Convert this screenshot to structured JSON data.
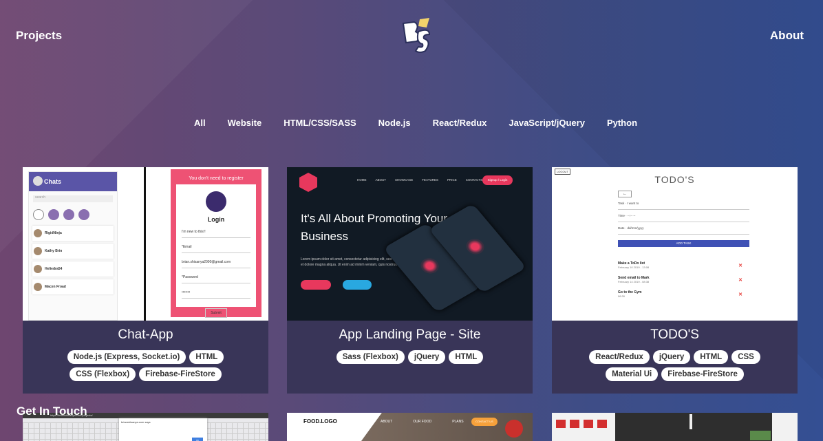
{
  "header": {
    "projects_label": "Projects",
    "about_label": "About",
    "logo_text": "BS"
  },
  "filters": [
    "All",
    "Website",
    "HTML/CSS/SASS",
    "Node.js",
    "React/Redux",
    "JavaScript/jQuery",
    "Python"
  ],
  "projects": [
    {
      "title": "Chat-App",
      "tags": [
        "Node.js (Express, Socket.io)",
        "HTML",
        "CSS (Flexbox)",
        "Firebase-FireStore"
      ],
      "preview": {
        "header": "Chats",
        "search_placeholder": "search",
        "contacts": [
          "RigidNinja",
          "Kathy Brin",
          "Heliedra54",
          "Macen Froad"
        ],
        "register_banner": "You don't need to register",
        "login_title": "Login",
        "checkbox_label": "I'm new to this!!",
        "email_label": "*Email",
        "email_value": "brian.shisanya2000@gmail.com",
        "password_label": "*Password",
        "password_value": "•••••••",
        "submit_label": "Submit"
      }
    },
    {
      "title": "App Landing Page - Site",
      "tags": [
        "Sass (Flexbox)",
        "jQuery",
        "HTML"
      ],
      "preview": {
        "menu": [
          "HOME",
          "ABOUT",
          "SHOWCASE",
          "FEATURES",
          "PRICE",
          "CONTACTS"
        ],
        "signup_label": "Signup / Login",
        "hero": "It's All About Promoting Your Business",
        "lorem": "Lorem ipsum dolor sit amet, consectetur adipisicing elit, sed do eiusmod tempor incididunt ut labore et dolore magna aliqua. Ut enim ad minim veniam, quis nostrud"
      }
    },
    {
      "title": "TODO'S",
      "tags": [
        "React/Redux",
        "jQuery",
        "HTML",
        "CSS",
        "Material Ui",
        "Firebase-FireStore"
      ],
      "preview": {
        "logout_label": "LOGOUT",
        "heading": "TODO'S",
        "task_label": "Task",
        "task_placeholder": "I want to",
        "time_label": "Time",
        "time_placeholder": "--:-- --",
        "date_label": "Date",
        "date_placeholder": "dd/mm/yyyy",
        "add_label": "ADD TASK",
        "items": [
          {
            "name": "Make a ToDo list",
            "when": "February 10 2019 - 13:08"
          },
          {
            "name": "Send email to Mark",
            "when": "February 14 2019 - 08:38"
          },
          {
            "name": "Go to the Gym",
            "when": "06:30"
          }
        ]
      }
    }
  ],
  "get_in_touch": "Get In Touch",
  "lower_previews": {
    "url_text": "https://brianshisanya.com/projects/",
    "dialog_text": "brianshisanya.com says",
    "ok_label": "OK",
    "food_logo": "FOOD.LOGO",
    "food_menu": [
      "ABOUT",
      "OUR FOOD",
      "PLANS"
    ],
    "contact_label": "CONTACT US"
  }
}
